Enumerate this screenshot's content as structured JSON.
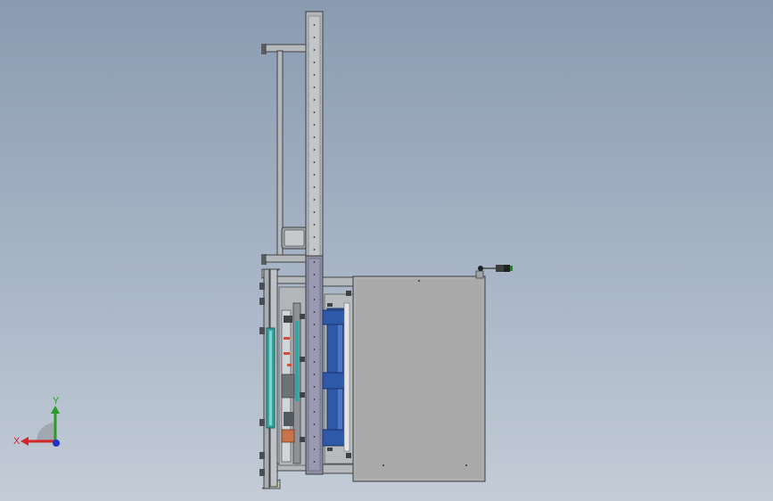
{
  "view": {
    "background_top": "#8a9bb1",
    "background_bottom": "#c3ccd7"
  },
  "colors": {
    "frame_steel": "#9ea3a8",
    "frame_dark": "#4a4e52",
    "panel_gray": "#a9a9a9",
    "column_purple": "#8d8ea6",
    "cyan_part": "#2fa6a2",
    "blue_part": "#2d59a8",
    "orange_part": "#c8734a"
  },
  "triad": {
    "x_label": "X",
    "y_label": "Y",
    "x_color": "#d0262a",
    "y_color": "#2a9a2a",
    "z_color": "#2035c8"
  }
}
